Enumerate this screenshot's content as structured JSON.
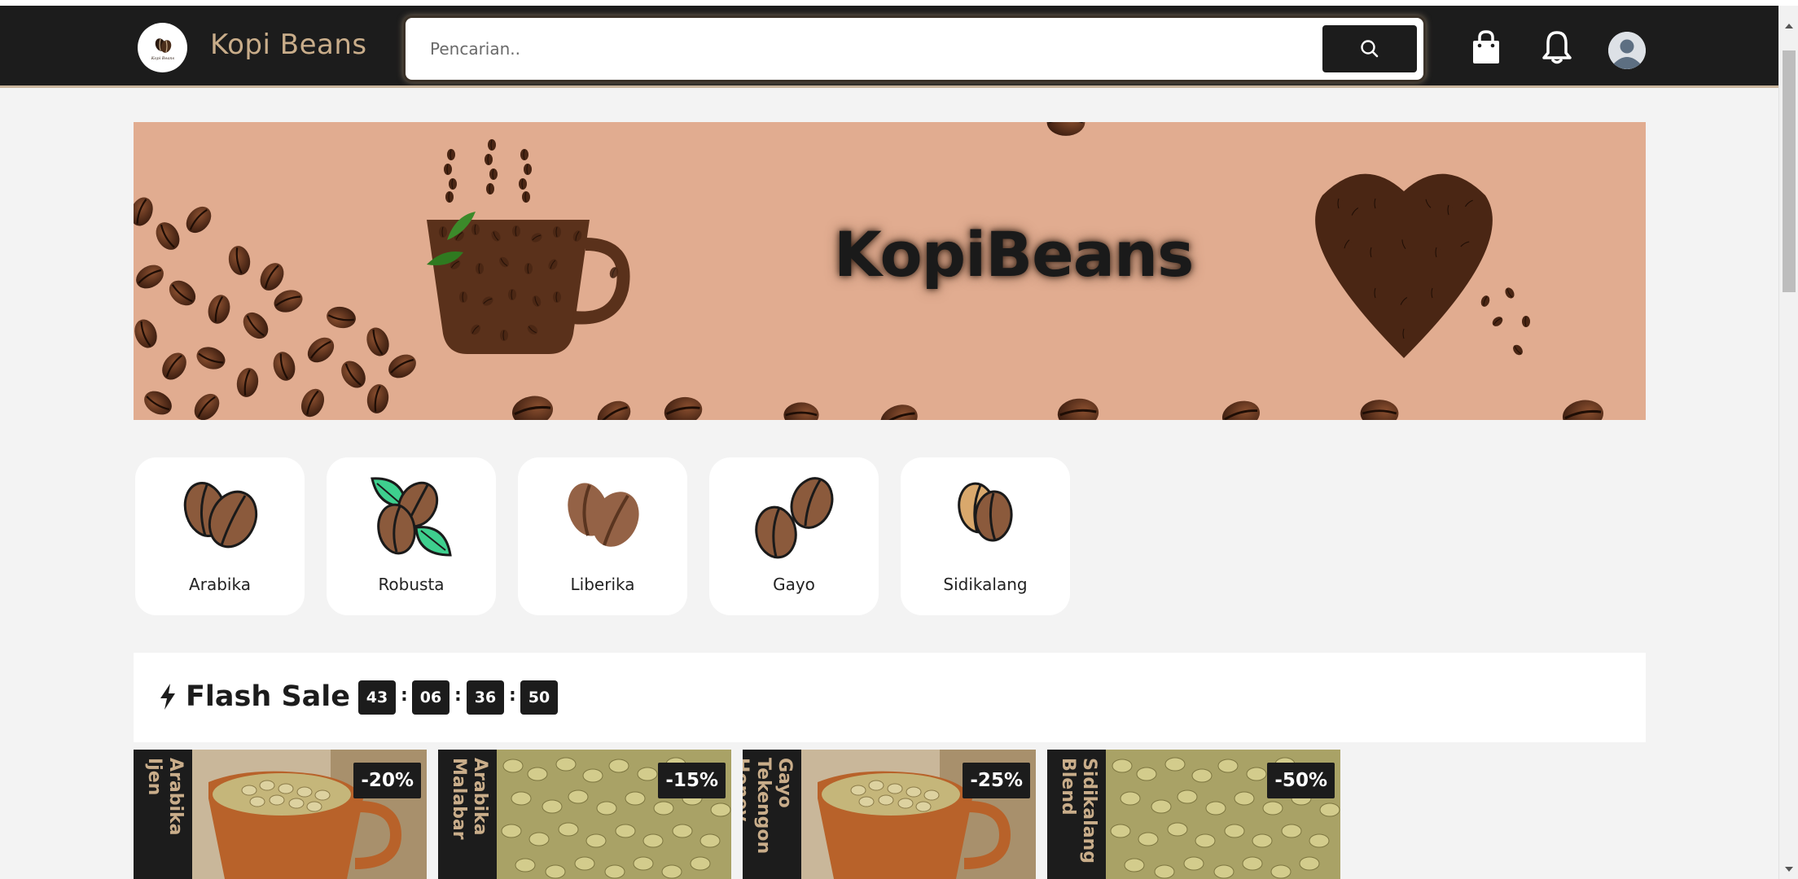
{
  "header": {
    "brand": "Kopi Beans",
    "logo_icon": "kopi-beans-logo",
    "search": {
      "placeholder": "Pencarian..",
      "button_icon": "search-icon"
    },
    "icons": [
      "shopping-bag-icon",
      "bell-icon",
      "user-avatar-icon"
    ]
  },
  "banner": {
    "title": "KopiBeans"
  },
  "categories": [
    {
      "label": "Arabika",
      "icon": "coffee-beans-icon"
    },
    {
      "label": "Robusta",
      "icon": "coffee-beans-leaves-icon"
    },
    {
      "label": "Liberika",
      "icon": "coffee-beans-icon"
    },
    {
      "label": "Gayo",
      "icon": "coffee-beans-icon"
    },
    {
      "label": "Sidikalang",
      "icon": "coffee-beans-icon"
    }
  ],
  "flash_sale": {
    "title": "Flash Sale",
    "icon": "lightning-icon",
    "timer": [
      "43",
      "06",
      "36",
      "50"
    ],
    "separator": ":"
  },
  "products": [
    {
      "name": "Arabika Ijen",
      "discount": "-20%"
    },
    {
      "name": "Arabika Malabar",
      "discount": "-15%"
    },
    {
      "name": "Gayo Tekengon Honey",
      "discount": "-25%"
    },
    {
      "name": "Sidikalang Blend",
      "discount": "-50%"
    }
  ],
  "colors": {
    "nav_bg": "#1c1c1c",
    "brand": "#c9ad8a",
    "banner_bg": "#e1ac90",
    "page_bg": "#f3f3f3"
  }
}
